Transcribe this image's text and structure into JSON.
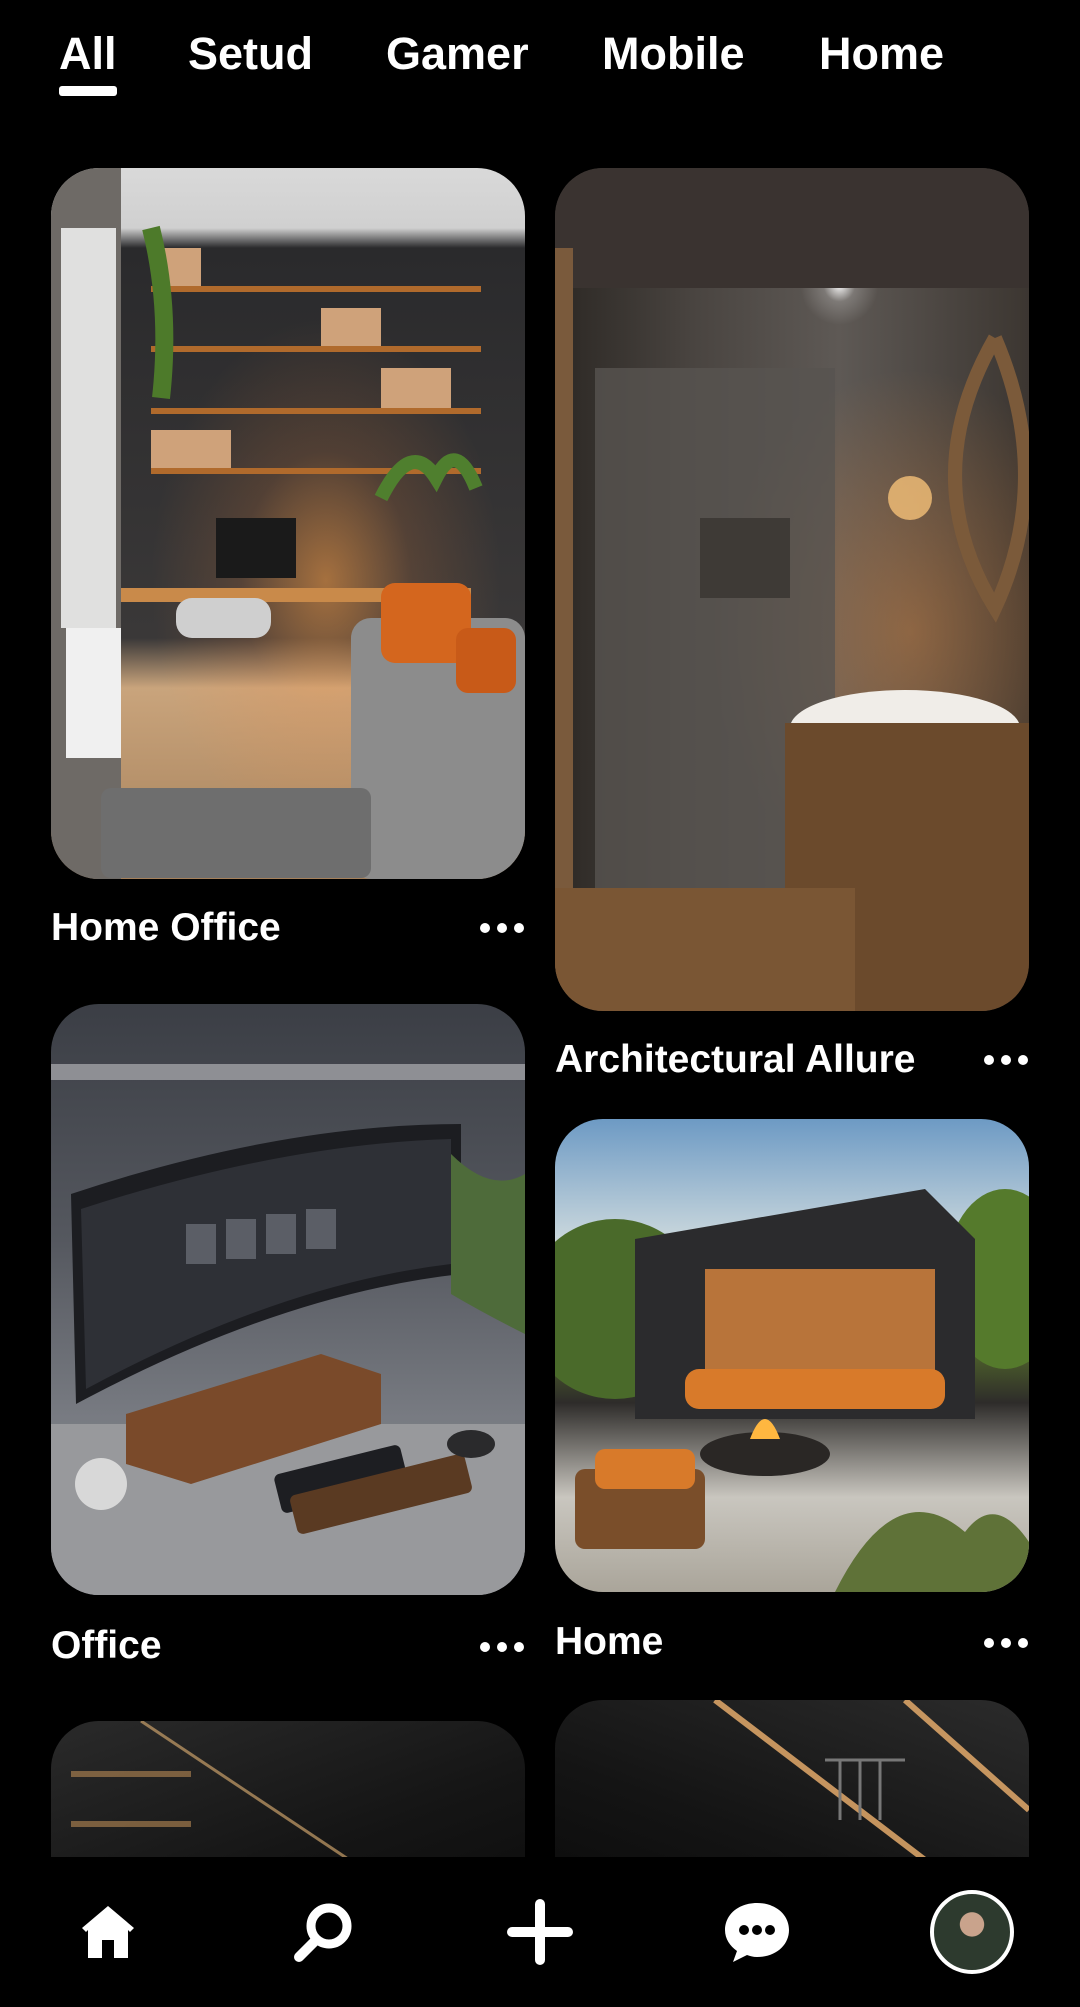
{
  "tabs": [
    {
      "label": "All",
      "active": true
    },
    {
      "label": "Setud",
      "active": false
    },
    {
      "label": "Gamer",
      "active": false
    },
    {
      "label": "Mobile",
      "active": false
    },
    {
      "label": "Home",
      "active": false
    }
  ],
  "pins": [
    {
      "title": "Home Office",
      "image": "home-office-photo"
    },
    {
      "title": "Architectural Allure",
      "image": "bathroom-photo"
    },
    {
      "title": "Office",
      "image": "desk-setup-photo"
    },
    {
      "title": "Home",
      "image": "patio-house-photo"
    }
  ],
  "more_icon": "more-dots-icon",
  "nav": {
    "home_icon": "home-icon",
    "search_icon": "search-icon",
    "create_icon": "plus-icon",
    "messages_icon": "chat-bubble-icon",
    "profile_icon": "avatar"
  }
}
